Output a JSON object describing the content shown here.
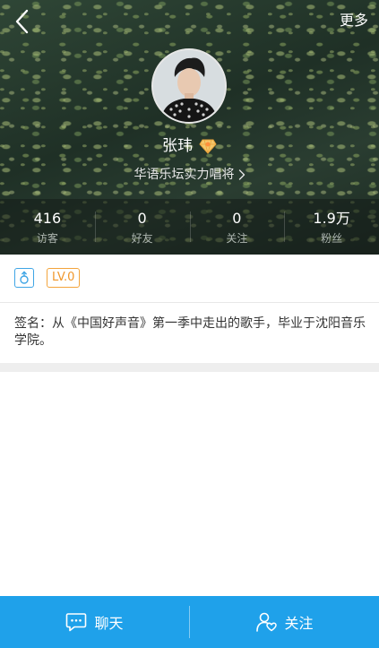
{
  "header": {
    "more_label": "更多"
  },
  "profile": {
    "name": "张玮",
    "title": "华语乐坛实力唱将"
  },
  "stats": [
    {
      "value": "416",
      "label": "访客"
    },
    {
      "value": "0",
      "label": "好友"
    },
    {
      "value": "0",
      "label": "关注"
    },
    {
      "value": "1.9万",
      "label": "粉丝"
    }
  ],
  "badges": {
    "level": "LV.0"
  },
  "signature": "签名：从《中国好声音》第一季中走出的歌手，毕业于沈阳音乐学院。",
  "actions": {
    "chat_label": "聊天",
    "follow_label": "关注"
  },
  "colors": {
    "accent": "#1fa1ea",
    "level_badge": "#f0962a",
    "gender_badge": "#3fa5e5"
  }
}
